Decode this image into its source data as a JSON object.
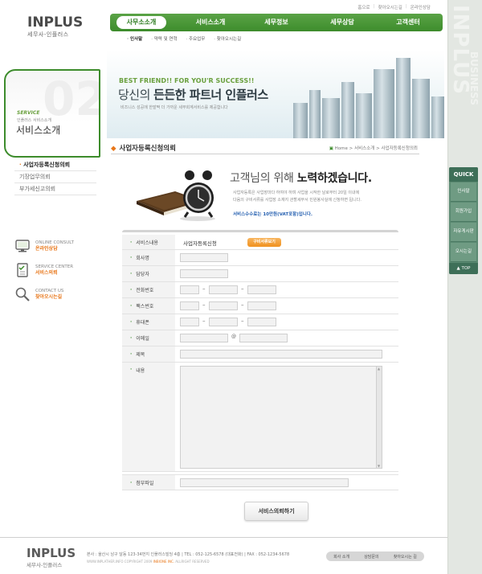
{
  "utility": [
    "홈으로",
    "찾아오시는길",
    "온라인상담"
  ],
  "logo": {
    "word": "INPLUS",
    "sub": "세무사-인플러스"
  },
  "gnb": [
    "사무소소개",
    "서비스소개",
    "세무정보",
    "세무상담",
    "고객센터"
  ],
  "lnb": [
    "인사말",
    "약력 및 연혁",
    "주요업무",
    "찾아오시는길"
  ],
  "banner": {
    "tag": "BEST FRIEND!! FOR YOU'R SUCCESS!!",
    "headline_pre": "당신의 ",
    "headline_bold": "든든한 파트너 인플러스",
    "desc": "비즈니스 성공에 한발짝 더 가까운 세무회계서비스를 제공합니다"
  },
  "section": {
    "number": "02",
    "label": "SERVICE",
    "sub": "인플러스 서비스소개",
    "title": "서비스소개"
  },
  "left_menu": [
    "사업자등록신청의뢰",
    "기장업무의뢰",
    "부가세신고의뢰"
  ],
  "left_boxes": [
    {
      "en": "ONLINE CONSULT",
      "ko": "온라인상담",
      "icon": "monitor-icon"
    },
    {
      "en": "SERVICE CENTER",
      "ko": "서비스의뢰",
      "icon": "checklist-icon"
    },
    {
      "en": "CONTACT US",
      "ko": "찾아오시는길",
      "icon": "magnifier-icon"
    }
  ],
  "page_title": "사업자등록신청의뢰",
  "breadcrumb": [
    "Home",
    "서비스소개",
    "사업자등록신청의뢰"
  ],
  "intro": {
    "heading_pre": "고객님의 위해 ",
    "heading_bold": "노력하겠습니다.",
    "p1": "사업자등록은 사업장마다 하여야 하며 사업을 시작한 날로부터 20일 이내에",
    "p2": "다음의 구비서류를 사업장 소재지 관할세무서 민원봉사실에 신청하면 됩니다.",
    "fee": "서비스수수료는 10만원(VAT포함)입니다."
  },
  "form": {
    "service_label": "서비스내용",
    "service_value": "사업자등록신청",
    "service_button": "구비서류보기",
    "company_label": "회사명",
    "manager_label": "담당자",
    "phone_label": "전화번호",
    "fax_label": "팩스번호",
    "mobile_label": "휴대폰",
    "email_label": "이메일",
    "email_at": "@",
    "subject_label": "제목",
    "content_label": "내용",
    "file_label": "첨부파일",
    "dash": "–"
  },
  "submit_label": "서비스의뢰하기",
  "quick": {
    "head": "QUICK",
    "items": [
      "인사말",
      "회원가입",
      "자유게시판",
      "오시는길"
    ],
    "top": "▲ TOP"
  },
  "side_logo": {
    "big": "INPLUS",
    "small": "BUSINESS"
  },
  "footer": {
    "logo_word": "INPLUS",
    "logo_sub": "세무사-인플러스",
    "address": "본사 : 울산시 남구 달동 123-34번지 인플러스빌딩 4층   |   TEL : 052-125-6578 (대표전화)   |   FAX : 052-1234-5678",
    "copy_pre": "WWW.INPLATHER.INFO   COPYRIGHT 2009 ",
    "copy_org": "INBIONE INC.",
    "copy_post": " ALLRIGHT RESERVED",
    "links": [
      "회사 소개",
      "상담문의",
      "찾아오시는 길"
    ]
  },
  "colors": {
    "green": "#3d8c2c",
    "orange": "#e8771a",
    "blue": "#245fb0",
    "side": "#e3e7e2"
  }
}
